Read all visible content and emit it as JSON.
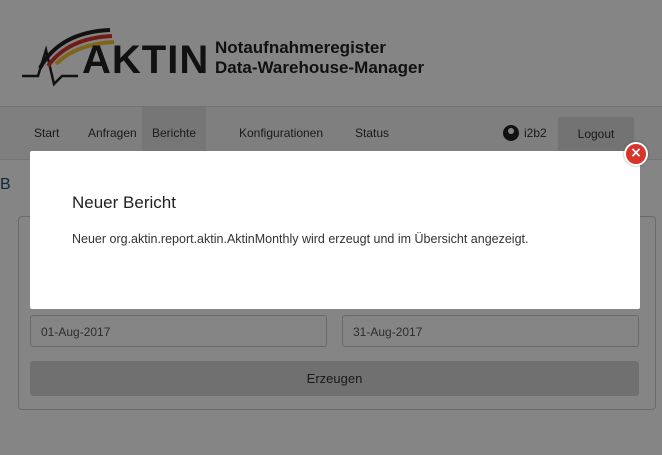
{
  "header": {
    "logo_text": "AKTIN",
    "subtitle_line1": "Notaufnahmeregister",
    "subtitle_line2": "Data-Warehouse-Manager"
  },
  "nav": {
    "items": [
      {
        "label": "Start"
      },
      {
        "label": "Anfragen"
      },
      {
        "label": "Berichte",
        "active": true
      },
      {
        "label": "Konfigurationen"
      },
      {
        "label": "Status"
      }
    ],
    "user": "i2b2",
    "logout_label": "Logout"
  },
  "page": {
    "heading_visible": "B",
    "start_date": "01-Aug-2017",
    "end_date": "31-Aug-2017",
    "generate_label": "Erzeugen"
  },
  "modal": {
    "title": "Neuer Bericht",
    "message": "Neuer org.aktin.report.aktin.AktinMonthly wird erzeugt und im Übersicht angezeigt.",
    "close_icon": "close-icon"
  },
  "colors": {
    "logo_red": "#d9342b",
    "logo_yellow": "#f2c230",
    "heading_blue": "#1f4e79",
    "close_red": "#d9342b"
  }
}
